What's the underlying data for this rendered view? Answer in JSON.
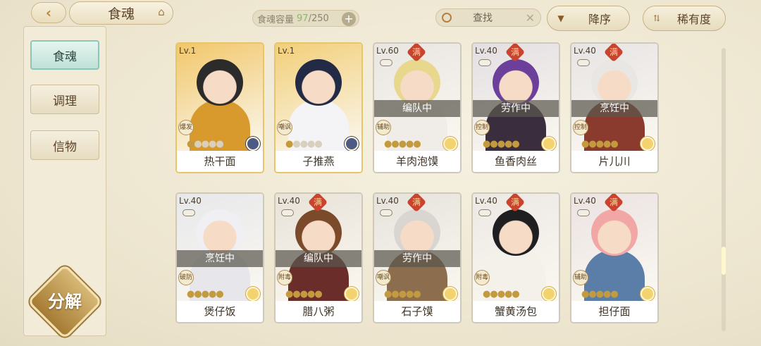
{
  "header": {
    "title": "食魂",
    "capacity_label": "食魂容量",
    "capacity_current": "97",
    "capacity_total": "/250",
    "search_label": "查找",
    "sort_order_label": "降序",
    "sort_key_label": "稀有度"
  },
  "sidebar": {
    "items": [
      {
        "label": "食魂"
      },
      {
        "label": "调理"
      },
      {
        "label": "信物"
      }
    ],
    "decompose_label": "分解"
  },
  "cards": [
    {
      "level": "Lv.1",
      "name": "热干面",
      "role": "爆发",
      "status": "",
      "full": false,
      "stars": 1
    },
    {
      "level": "Lv.1",
      "name": "子推燕",
      "role": "嘲讽",
      "status": "",
      "full": false,
      "stars": 1
    },
    {
      "level": "Lv.60",
      "name": "羊肉泡馍",
      "role": "辅助",
      "status": "编队中",
      "full": true,
      "stars": 5
    },
    {
      "level": "Lv.40",
      "name": "鱼香肉丝",
      "role": "控制",
      "status": "劳作中",
      "full": true,
      "stars": 5
    },
    {
      "level": "Lv.40",
      "name": "片儿川",
      "role": "控制",
      "status": "烹饪中",
      "full": true,
      "stars": 5
    },
    {
      "level": "Lv.40",
      "name": "煲仔饭",
      "role": "破防",
      "status": "烹饪中",
      "full": false,
      "stars": 5
    },
    {
      "level": "Lv.40",
      "name": "腊八粥",
      "role": "附毒",
      "status": "编队中",
      "full": true,
      "stars": 5
    },
    {
      "level": "Lv.40",
      "name": "石子馍",
      "role": "嘲讽",
      "status": "劳作中",
      "full": true,
      "stars": 5
    },
    {
      "level": "Lv.40",
      "name": "蟹黄汤包",
      "role": "附毒",
      "status": "",
      "full": true,
      "stars": 5
    },
    {
      "level": "Lv.40",
      "name": "担仔面",
      "role": "辅助",
      "status": "",
      "full": true,
      "stars": 5
    }
  ],
  "full_badge": "满",
  "colors": {
    "background": "#efe8d3",
    "accent_teal": "#8cc6b7",
    "gold": "#c49a3e",
    "status_overlay": "#5a584e"
  }
}
